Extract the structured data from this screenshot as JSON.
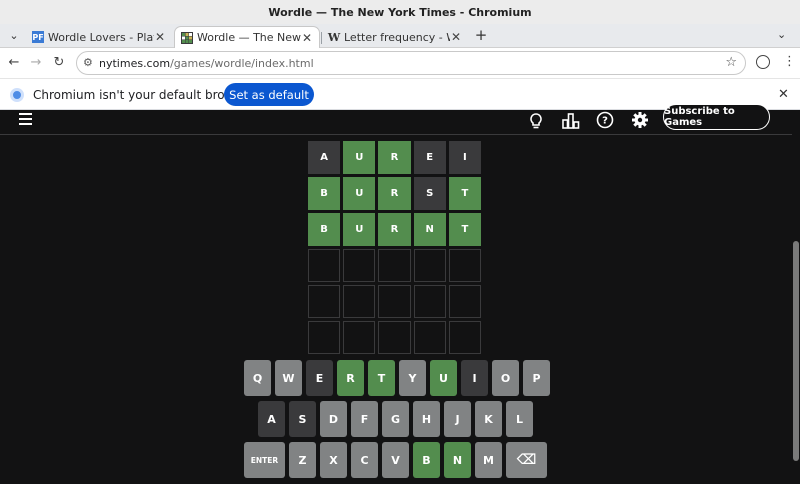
{
  "window": {
    "title": "Wordle — The New York Times - Chromium"
  },
  "tabs": [
    {
      "title": "Wordle Lovers - Play th",
      "favicon": "PF",
      "active": false
    },
    {
      "title": "Wordle — The New Yo",
      "favicon": "grid",
      "active": true
    },
    {
      "title": "Letter frequency - Wiki",
      "favicon": "W",
      "active": false
    }
  ],
  "toolbar": {
    "url_host": "nytimes.com",
    "url_path": "/games/wordle/index.html"
  },
  "infobar": {
    "message": "Chromium isn't your default browser",
    "button": "Set as default"
  },
  "game_header": {
    "subscribe_label": "Subscribe to Games",
    "icons": [
      "hamburger-menu-icon",
      "hint-bulb-icon",
      "stats-icon",
      "help-icon",
      "settings-gear-icon"
    ]
  },
  "board": {
    "rows": [
      [
        {
          "l": "A",
          "s": "absent"
        },
        {
          "l": "U",
          "s": "correct"
        },
        {
          "l": "R",
          "s": "correct"
        },
        {
          "l": "E",
          "s": "absent"
        },
        {
          "l": "I",
          "s": "absent"
        }
      ],
      [
        {
          "l": "B",
          "s": "correct"
        },
        {
          "l": "U",
          "s": "correct"
        },
        {
          "l": "R",
          "s": "correct"
        },
        {
          "l": "S",
          "s": "absent"
        },
        {
          "l": "T",
          "s": "correct"
        }
      ],
      [
        {
          "l": "B",
          "s": "correct"
        },
        {
          "l": "U",
          "s": "correct"
        },
        {
          "l": "R",
          "s": "correct"
        },
        {
          "l": "N",
          "s": "correct"
        },
        {
          "l": "T",
          "s": "correct"
        }
      ],
      [
        {
          "l": "",
          "s": "empty"
        },
        {
          "l": "",
          "s": "empty"
        },
        {
          "l": "",
          "s": "empty"
        },
        {
          "l": "",
          "s": "empty"
        },
        {
          "l": "",
          "s": "empty"
        }
      ],
      [
        {
          "l": "",
          "s": "empty"
        },
        {
          "l": "",
          "s": "empty"
        },
        {
          "l": "",
          "s": "empty"
        },
        {
          "l": "",
          "s": "empty"
        },
        {
          "l": "",
          "s": "empty"
        }
      ],
      [
        {
          "l": "",
          "s": "empty"
        },
        {
          "l": "",
          "s": "empty"
        },
        {
          "l": "",
          "s": "empty"
        },
        {
          "l": "",
          "s": "empty"
        },
        {
          "l": "",
          "s": "empty"
        }
      ]
    ]
  },
  "keyboard": {
    "rows": [
      [
        {
          "k": "Q",
          "s": "unused"
        },
        {
          "k": "W",
          "s": "unused"
        },
        {
          "k": "E",
          "s": "absent"
        },
        {
          "k": "R",
          "s": "correct"
        },
        {
          "k": "T",
          "s": "correct"
        },
        {
          "k": "Y",
          "s": "unused"
        },
        {
          "k": "U",
          "s": "correct"
        },
        {
          "k": "I",
          "s": "absent"
        },
        {
          "k": "O",
          "s": "unused"
        },
        {
          "k": "P",
          "s": "unused"
        }
      ],
      [
        {
          "k": "A",
          "s": "absent"
        },
        {
          "k": "S",
          "s": "absent"
        },
        {
          "k": "D",
          "s": "unused"
        },
        {
          "k": "F",
          "s": "unused"
        },
        {
          "k": "G",
          "s": "unused"
        },
        {
          "k": "H",
          "s": "unused"
        },
        {
          "k": "J",
          "s": "unused"
        },
        {
          "k": "K",
          "s": "unused"
        },
        {
          "k": "L",
          "s": "unused"
        }
      ],
      [
        {
          "k": "ENTER",
          "s": "unused"
        },
        {
          "k": "Z",
          "s": "unused"
        },
        {
          "k": "X",
          "s": "unused"
        },
        {
          "k": "C",
          "s": "unused"
        },
        {
          "k": "V",
          "s": "unused"
        },
        {
          "k": "B",
          "s": "correct"
        },
        {
          "k": "N",
          "s": "correct"
        },
        {
          "k": "M",
          "s": "unused"
        },
        {
          "k": "⌫",
          "s": "unused"
        }
      ]
    ]
  },
  "colors": {
    "correct": "#538d4e",
    "absent": "#3a3a3c",
    "unused": "#818384",
    "background": "#121213",
    "accent_button": "#0b57d0"
  }
}
